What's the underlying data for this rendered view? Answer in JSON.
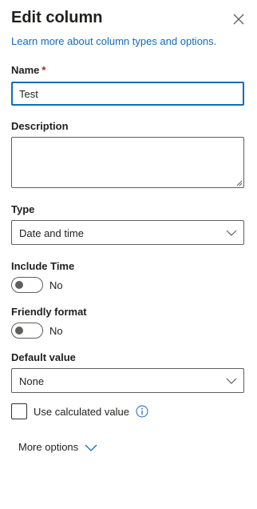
{
  "panel": {
    "title": "Edit column",
    "close_icon": "close-icon",
    "learn_more_link": "Learn more about column types and options."
  },
  "fields": {
    "name": {
      "label": "Name",
      "required_marker": "*",
      "value": "Test"
    },
    "description": {
      "label": "Description",
      "value": ""
    },
    "type": {
      "label": "Type",
      "selected": "Date and time",
      "icon": "chevron-down-icon"
    },
    "include_time": {
      "label": "Include Time",
      "state_text": "No",
      "on": false
    },
    "friendly_format": {
      "label": "Friendly format",
      "state_text": "No",
      "on": false
    },
    "default_value": {
      "label": "Default value",
      "selected": "None",
      "icon": "chevron-down-icon"
    },
    "use_calculated": {
      "label": "Use calculated value",
      "checked": false,
      "icon": "info-icon"
    }
  },
  "more_options": {
    "label": "More options",
    "icon": "chevron-down-icon"
  },
  "colors": {
    "accent": "#0f6cbd",
    "text": "#201f1e",
    "border": "#605e5c",
    "required": "#a4262c"
  }
}
